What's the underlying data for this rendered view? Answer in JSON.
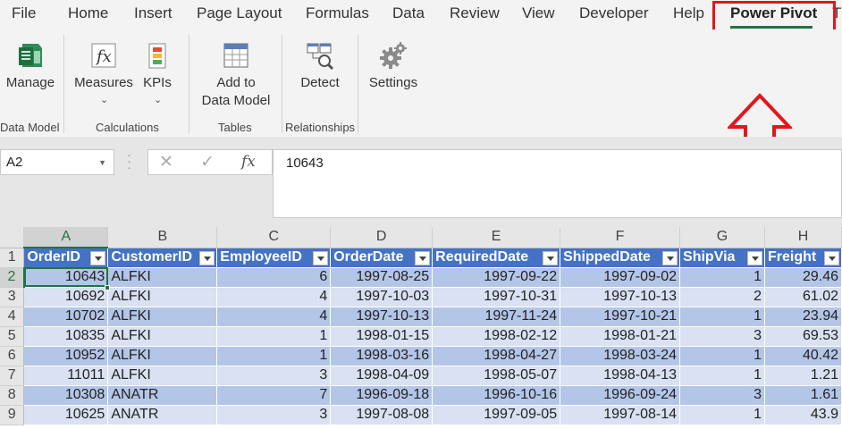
{
  "ribbon_tabs": [
    "File",
    "Home",
    "Insert",
    "Page Layout",
    "Formulas",
    "Data",
    "Review",
    "View",
    "Developer",
    "Help",
    "Power Pivot",
    "T"
  ],
  "active_tab": "Power Pivot",
  "ribbon": {
    "manage": "Manage",
    "measures": "Measures",
    "kpis": "KPIs",
    "add_line1": "Add to",
    "add_line2": "Data Model",
    "detect": "Detect",
    "settings": "Settings",
    "groups": {
      "data_model": "Data Model",
      "calculations": "Calculations",
      "tables": "Tables",
      "relationships": "Relationships"
    }
  },
  "formula_bar": {
    "name_box": "A2",
    "fx": "fx",
    "cancel": "✕",
    "enter": "✓",
    "value": "10643"
  },
  "colors": {
    "accent": "#217346",
    "highlight": "#e3161e",
    "table_header": "#4472c4",
    "band_dark": "#b4c6e7",
    "band_light": "#d9e1f2"
  },
  "sheet": {
    "column_letters": [
      "A",
      "B",
      "C",
      "D",
      "E",
      "F",
      "G",
      "H"
    ],
    "row_numbers": [
      "1",
      "2",
      "3",
      "4",
      "5",
      "6",
      "7",
      "8",
      "9"
    ],
    "headers": [
      "OrderID",
      "CustomerID",
      "EmployeeID",
      "OrderDate",
      "RequiredDate",
      "ShippedDate",
      "ShipVia",
      "Freight"
    ],
    "rows": [
      [
        "10643",
        "ALFKI",
        "6",
        "1997-08-25",
        "1997-09-22",
        "1997-09-02",
        "1",
        "29.46"
      ],
      [
        "10692",
        "ALFKI",
        "4",
        "1997-10-03",
        "1997-10-31",
        "1997-10-13",
        "2",
        "61.02"
      ],
      [
        "10702",
        "ALFKI",
        "4",
        "1997-10-13",
        "1997-11-24",
        "1997-10-21",
        "1",
        "23.94"
      ],
      [
        "10835",
        "ALFKI",
        "1",
        "1998-01-15",
        "1998-02-12",
        "1998-01-21",
        "3",
        "69.53"
      ],
      [
        "10952",
        "ALFKI",
        "1",
        "1998-03-16",
        "1998-04-27",
        "1998-03-24",
        "1",
        "40.42"
      ],
      [
        "11011",
        "ALFKI",
        "3",
        "1998-04-09",
        "1998-05-07",
        "1998-04-13",
        "1",
        "1.21"
      ],
      [
        "10308",
        "ANATR",
        "7",
        "1996-09-18",
        "1996-10-16",
        "1996-09-24",
        "3",
        "1.61"
      ],
      [
        "10625",
        "ANATR",
        "3",
        "1997-08-08",
        "1997-09-05",
        "1997-08-14",
        "1",
        "43.9"
      ]
    ]
  }
}
